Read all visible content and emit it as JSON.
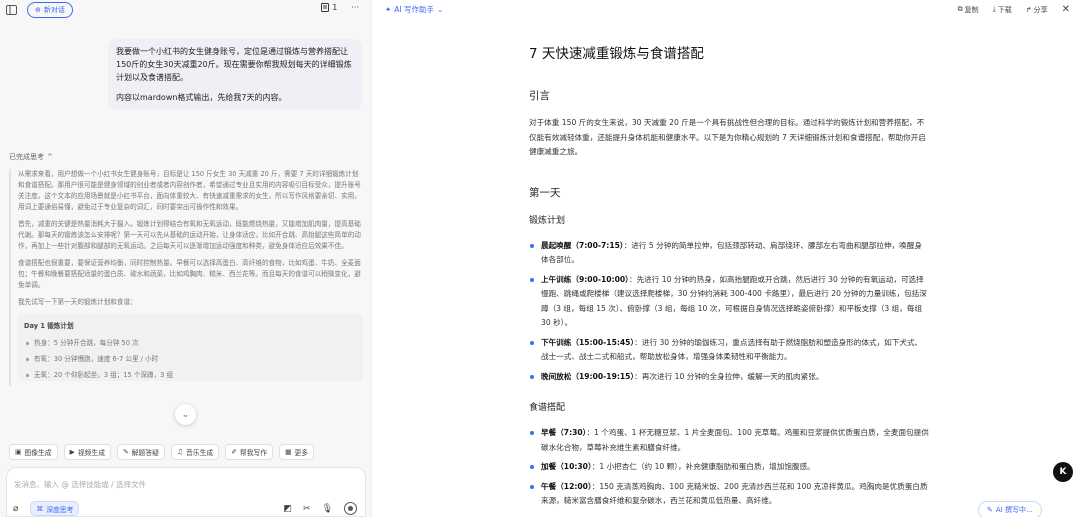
{
  "left": {
    "new_chat": "新对话",
    "doc_count": "1",
    "more": "···",
    "user_message": [
      "我要做一个小红书的女生健身账号，定位是通过锻炼与营养搭配让150斤的女生30天减重20斤。现在需要你帮我规划每天的详细锻炼计划以及食谱搭配。",
      "内容以mardown格式输出，先给我7天的内容。"
    ],
    "think_header": "已完成思考",
    "think_paragraphs": [
      "从需求来看，用户想做一个小红书女生健身账号，目标是让 150 斤女生 30 天减重 20 斤，需要 7 天的详细锻炼计划和食谱搭配。那用户很可能是健身领域的创业者或者内容创作者，希望通过专业且实用的内容吸引目标受众，提升账号关注度。这个文本的应用场景就是小红书平台，面向体重较大、有快速减重需求的女生，所以写作风格要亲切、实用，用词上要通俗易懂，避免过于专业复杂的词汇，同时要突出可操作性和效果。",
      "首先，减重的关键是热量消耗大于摄入。锻炼计划得结合有氧和无氧运动，既能燃烧热量，又能增加肌肉量，提高基础代谢。那每天的锻炼该怎么安排呢？第一天可以先从基础的运动开始，让身体适应，比如开合跳、高抬腿这些简单的动作，再加上一些针对腹部和腿部的无氧运动。之后每天可以逐渐增加运动强度和种类，避免身体适应后效果不佳。",
      "食谱搭配也很重要，要保证营养均衡，同时控制热量。早餐可以选择高蛋白、高纤维的食物，比如鸡蛋、牛奶、全麦面包；午餐和晚餐要搭配适量的蛋白质、碳水和蔬菜，比如鸡胸肉、糙米、西兰花等。而且每天的食谱可以稍微变化，避免单调。",
      "我先试写一下第一天的锻炼计划和食谱："
    ],
    "day_title": "Day 1 锻炼计划",
    "day_items": [
      "热身：5 分钟开合跳，每分钟 50 次",
      "有氧：30 分钟慢跑，速度 6-7 公里 / 小时",
      "无氧：20 个仰卧起坐，3 组；15 个深蹲，3 组"
    ],
    "tools": [
      "图像生成",
      "视频生成",
      "解题答疑",
      "音乐生成",
      "帮我写作",
      "更多"
    ],
    "input_placeholder": "发消息、输入 @ 选择技能或 / 选择文件",
    "deep_think": "深度思考"
  },
  "right": {
    "assistant_label": "AI 写作助手",
    "actions": [
      "复制",
      "下载",
      "分享"
    ],
    "doc": {
      "title": "7 天快速减重锻炼与食谱搭配",
      "intro_heading": "引言",
      "intro": "对于体重 150 斤的女生来说，30 天减重 20 斤是一个具有挑战性但合理的目标。通过科学的锻炼计划和营养搭配，不仅能有效减轻体重，还能提升身体机能和健康水平。以下是为你精心规划的 7 天详细锻炼计划和食谱搭配，帮助你开启健康减重之旅。",
      "day1_heading": "第一天",
      "exercise_heading": "锻炼计划",
      "exercise": [
        {
          "b": "晨起唤醒（7:00-7:15）",
          "t": "：进行 5 分钟的简单拉伸，包括颈部转动、肩部绕环、腰部左右弯曲和腿部拉伸，唤醒身体各部位。"
        },
        {
          "b": "上午训练（9:00-10:00）",
          "t": "：先进行 10 分钟的热身，如高抬腿跑或开合跳，然后进行 30 分钟的有氧运动，可选择慢跑、跳绳或爬楼梯（建议选择爬楼梯，30 分钟约消耗 300-400 卡路里），最后进行 20 分钟的力量训练，包括深蹲（3 组，每组 15 次）、俯卧撑（3 组，每组 10 次，可根据自身情况选择跪姿俯卧撑）和平板支撑（3 组，每组 30 秒）。"
        },
        {
          "b": "下午训练（15:00-15:45）",
          "t": "：进行 30 分钟的瑜伽练习，重点选择有助于燃烧脂肪和塑造身形的体式，如下犬式、战士一式、战士二式和船式，帮助放松身体，增强身体柔韧性和平衡能力。"
        },
        {
          "b": "晚间放松（19:00-19:15）",
          "t": "：再次进行 10 分钟的全身拉伸，缓解一天的肌肉紧张。"
        }
      ],
      "diet_heading": "食谱搭配",
      "diet": [
        {
          "b": "早餐（7:30）",
          "t": "：1 个鸡蛋、1 杯无糖豆浆、1 片全麦面包、100 克草莓。鸡蛋和豆浆提供优质蛋白质，全麦面包提供碳水化合物，草莓补充维生素和膳食纤维。"
        },
        {
          "b": "加餐（10:30）",
          "t": "：1 小把杏仁（约 10 颗），补充健康脂肪和蛋白质，增加饱腹感。"
        },
        {
          "b": "午餐（12:00）",
          "t": "：150 克清蒸鸡胸肉、100 克糙米饭、200 克清炒西兰花和 100 克凉拌黄瓜。鸡胸肉是优质蛋白质来源，糙米富含膳食纤维和复杂碳水，西兰花和黄瓜低热量、高纤维。"
        }
      ]
    },
    "writing_badge": "AI 撰写中..."
  }
}
